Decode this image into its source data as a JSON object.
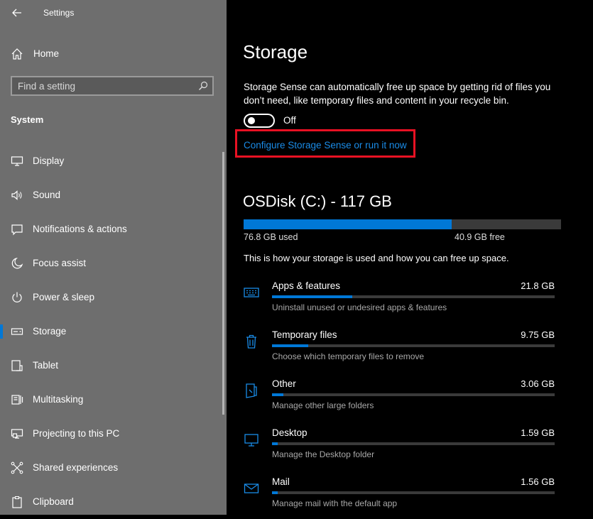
{
  "window": {
    "title": "Settings"
  },
  "sidebar": {
    "home_label": "Home",
    "search_placeholder": "Find a setting",
    "section_label": "System",
    "items": [
      {
        "id": "display",
        "label": "Display",
        "icon": "monitor-icon"
      },
      {
        "id": "sound",
        "label": "Sound",
        "icon": "speaker-icon"
      },
      {
        "id": "notifications",
        "label": "Notifications & actions",
        "icon": "message-icon"
      },
      {
        "id": "focus",
        "label": "Focus assist",
        "icon": "moon-icon"
      },
      {
        "id": "power",
        "label": "Power & sleep",
        "icon": "power-icon"
      },
      {
        "id": "storage",
        "label": "Storage",
        "icon": "storage-icon",
        "selected": true
      },
      {
        "id": "tablet",
        "label": "Tablet",
        "icon": "tablet-icon"
      },
      {
        "id": "multitasking",
        "label": "Multitasking",
        "icon": "multitasking-icon"
      },
      {
        "id": "projecting",
        "label": "Projecting to this PC",
        "icon": "projector-icon"
      },
      {
        "id": "shared",
        "label": "Shared experiences",
        "icon": "share-icon"
      },
      {
        "id": "clipboard",
        "label": "Clipboard",
        "icon": "clipboard-icon"
      }
    ]
  },
  "main": {
    "title": "Storage",
    "description": "Storage Sense can automatically free up space by getting rid of files you don’t need, like temporary files and content in your recycle bin.",
    "toggle_state": "Off",
    "configure_link": "Configure Storage Sense or run it now",
    "disk_title": "OSDisk (C:) - 117 GB",
    "disk_used_label": "76.8 GB used",
    "disk_free_label": "40.9 GB free",
    "disk_used_fraction": 0.656,
    "usage_intro": "This is how your storage is used and how you can free up space.",
    "categories": [
      {
        "name": "Apps & features",
        "size": "21.8 GB",
        "sub": "Uninstall unused or undesired apps & features",
        "icon": "keyboard-icon",
        "fraction": 0.284
      },
      {
        "name": "Temporary files",
        "size": "9.75 GB",
        "sub": "Choose which temporary files to remove",
        "icon": "trash-icon",
        "fraction": 0.128
      },
      {
        "name": "Other",
        "size": "3.06 GB",
        "sub": "Manage other large folders",
        "icon": "folder-icon",
        "fraction": 0.04
      },
      {
        "name": "Desktop",
        "size": "1.59 GB",
        "sub": "Manage the Desktop folder",
        "icon": "desktop-icon",
        "fraction": 0.021
      },
      {
        "name": "Mail",
        "size": "1.56 GB",
        "sub": "Manage mail with the default app",
        "icon": "mail-icon",
        "fraction": 0.02
      }
    ]
  },
  "colors": {
    "accent": "#0078d7",
    "link": "#1a8ce8",
    "highlight_box": "#e81123",
    "sidebar_bg": "#6e6e6e",
    "main_bg": "#000000"
  }
}
